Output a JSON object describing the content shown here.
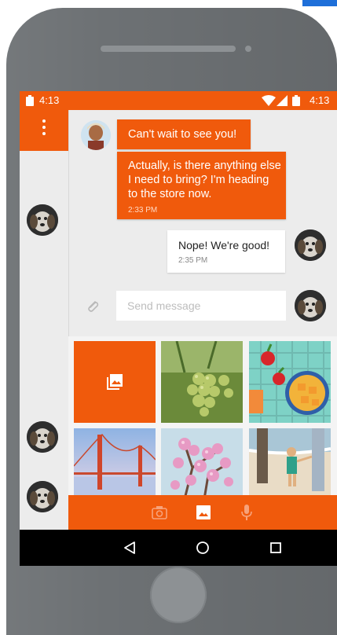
{
  "status_bar": {
    "time_left": "4:13",
    "time_right": "4:13"
  },
  "messages": [
    {
      "side": "incoming",
      "text": "Can't wait to see you!"
    },
    {
      "side": "incoming",
      "text": "Actually, is there anything else I need to bring? I'm heading to the store now.",
      "time": "2:33 PM"
    },
    {
      "side": "outgoing",
      "text": "Nope! We're good!",
      "time": "2:35 PM"
    }
  ],
  "composer": {
    "placeholder": "Send message"
  },
  "gallery": {
    "tiles": [
      "grapes",
      "fruit-bowl",
      "golden-gate-bridge",
      "cherry-blossoms",
      "beach-family"
    ]
  },
  "media_toolbar": {
    "items": [
      "camera-icon",
      "image-icon",
      "microphone-icon"
    ],
    "active": "image-icon"
  },
  "nav_bar": {
    "items": [
      "back-icon",
      "home-icon",
      "recents-icon"
    ]
  },
  "colors": {
    "accent": "#f05a0c",
    "phone_body": "#6d7174",
    "screen_bg": "#ececec"
  }
}
